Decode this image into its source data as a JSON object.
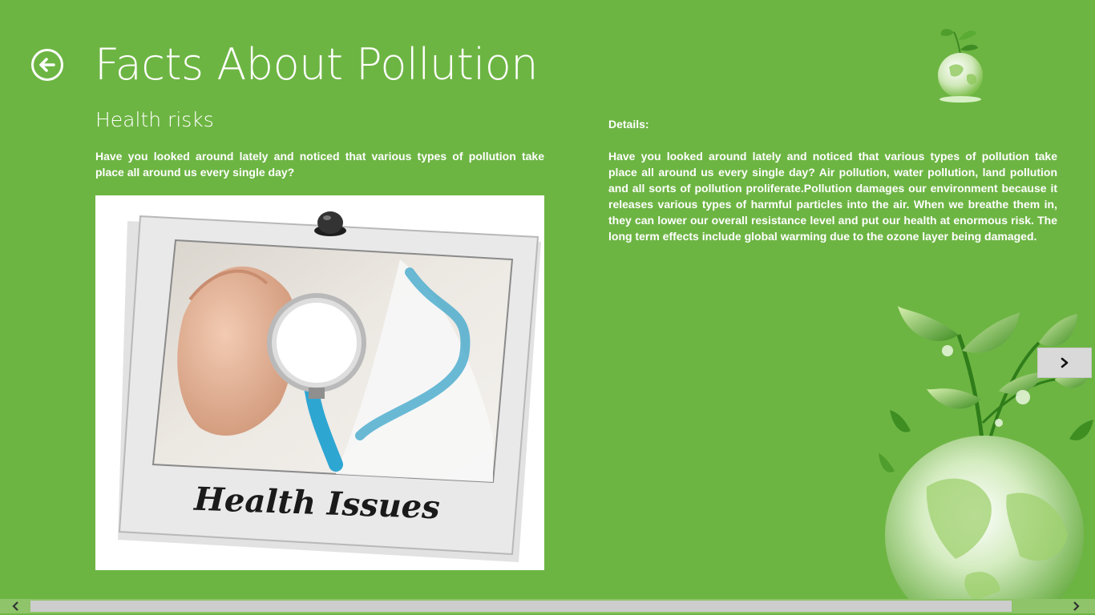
{
  "header": {
    "title": "Facts About Pollution",
    "back_icon": "back-arrow-icon"
  },
  "section": {
    "subtitle": "Health risks",
    "summary": "Have you looked around lately and noticed that various types of pollution take place all around us every single day?",
    "image_caption": "Health Issues"
  },
  "details": {
    "heading": "Details:",
    "body": "Have you looked around lately and noticed that various types of pollution take place all around us every single day? Air pollution, water pollution, land pollution and all sorts of pollution proliferate.Pollution damages our environment because it releases various types of harmful particles into the air. When we breathe them in, they can lower our overall resistance level and put our health at enormous risk. The long term effects include global warming due to the ozone layer being damaged."
  },
  "navigation": {
    "next_icon": "chevron-right-icon"
  },
  "scrollbar": {
    "left_icon": "chevron-left-icon",
    "right_icon": "chevron-right-icon"
  },
  "colors": {
    "background": "#6db543",
    "text": "#ffffff",
    "next_button": "#d9d9d9",
    "scrollbar_thumb": "#cdcdcd"
  }
}
